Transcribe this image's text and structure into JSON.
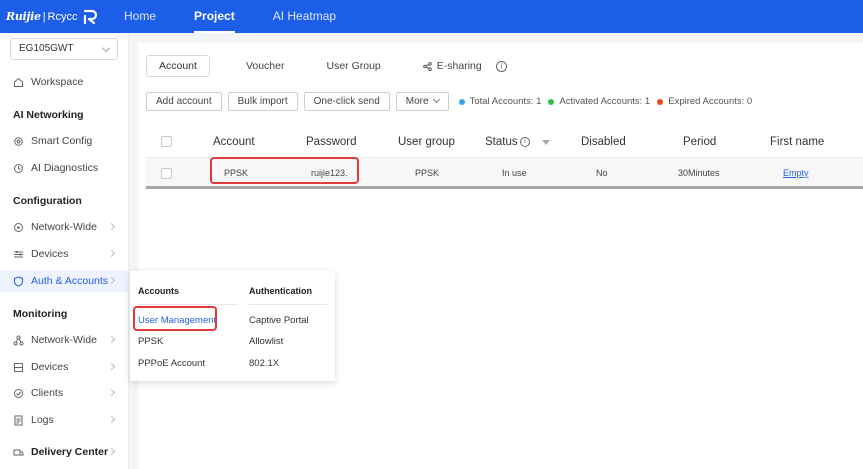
{
  "brand": {
    "name": "Ruijie",
    "separator": "|",
    "product": "Rcycc"
  },
  "topnav": {
    "items": [
      "Home",
      "Project",
      "AI Heatmap"
    ],
    "active": "Project"
  },
  "sidebar": {
    "device": "EG105GWT",
    "workspace": "Workspace",
    "sections": {
      "ai_networking": "AI Networking",
      "configuration": "Configuration",
      "monitoring": "Monitoring",
      "delivery": "Delivery Center"
    },
    "items": {
      "smart_config": "Smart Config",
      "ai_diagnostics": "AI Diagnostics",
      "network_wide": "Network-Wide",
      "devices": "Devices",
      "auth_accounts": "Auth & Accounts",
      "mon_network_wide": "Network-Wide",
      "mon_devices": "Devices",
      "clients": "Clients",
      "logs": "Logs"
    }
  },
  "tabs": {
    "account": "Account",
    "voucher": "Voucher",
    "user_group": "User Group",
    "esharing": "E-sharing"
  },
  "actions": {
    "add_account": "Add account",
    "bulk_import": "Bulk import",
    "one_click_send": "One-click send",
    "more": "More",
    "total": "Total Accounts: 1",
    "activated": "Activated Accounts: 1",
    "expired": "Expired Accounts: 0"
  },
  "colors": {
    "accent": "#1d5ee9",
    "total_dot": "#3aa0e8",
    "activated_dot": "#2fbf4a",
    "expired_dot": "#e84a1a",
    "highlight": "#e03a3a"
  },
  "table": {
    "headers": {
      "account": "Account",
      "password": "Password",
      "user_group": "User group",
      "status": "Status",
      "disabled": "Disabled",
      "period": "Period",
      "first_name": "First name"
    },
    "rows": [
      {
        "account": "PPSK",
        "password": "ruijie123.",
        "user_group": "PPSK",
        "status": "In use",
        "disabled": "No",
        "period": "30Minutes",
        "first_name": "Empty"
      }
    ]
  },
  "popup": {
    "accounts_head": "Accounts",
    "auth_head": "Authentication",
    "accounts": [
      "User Management",
      "PPSK",
      "PPPoE Account"
    ],
    "auth": [
      "Captive Portal",
      "Allowlist",
      "802.1X"
    ]
  }
}
